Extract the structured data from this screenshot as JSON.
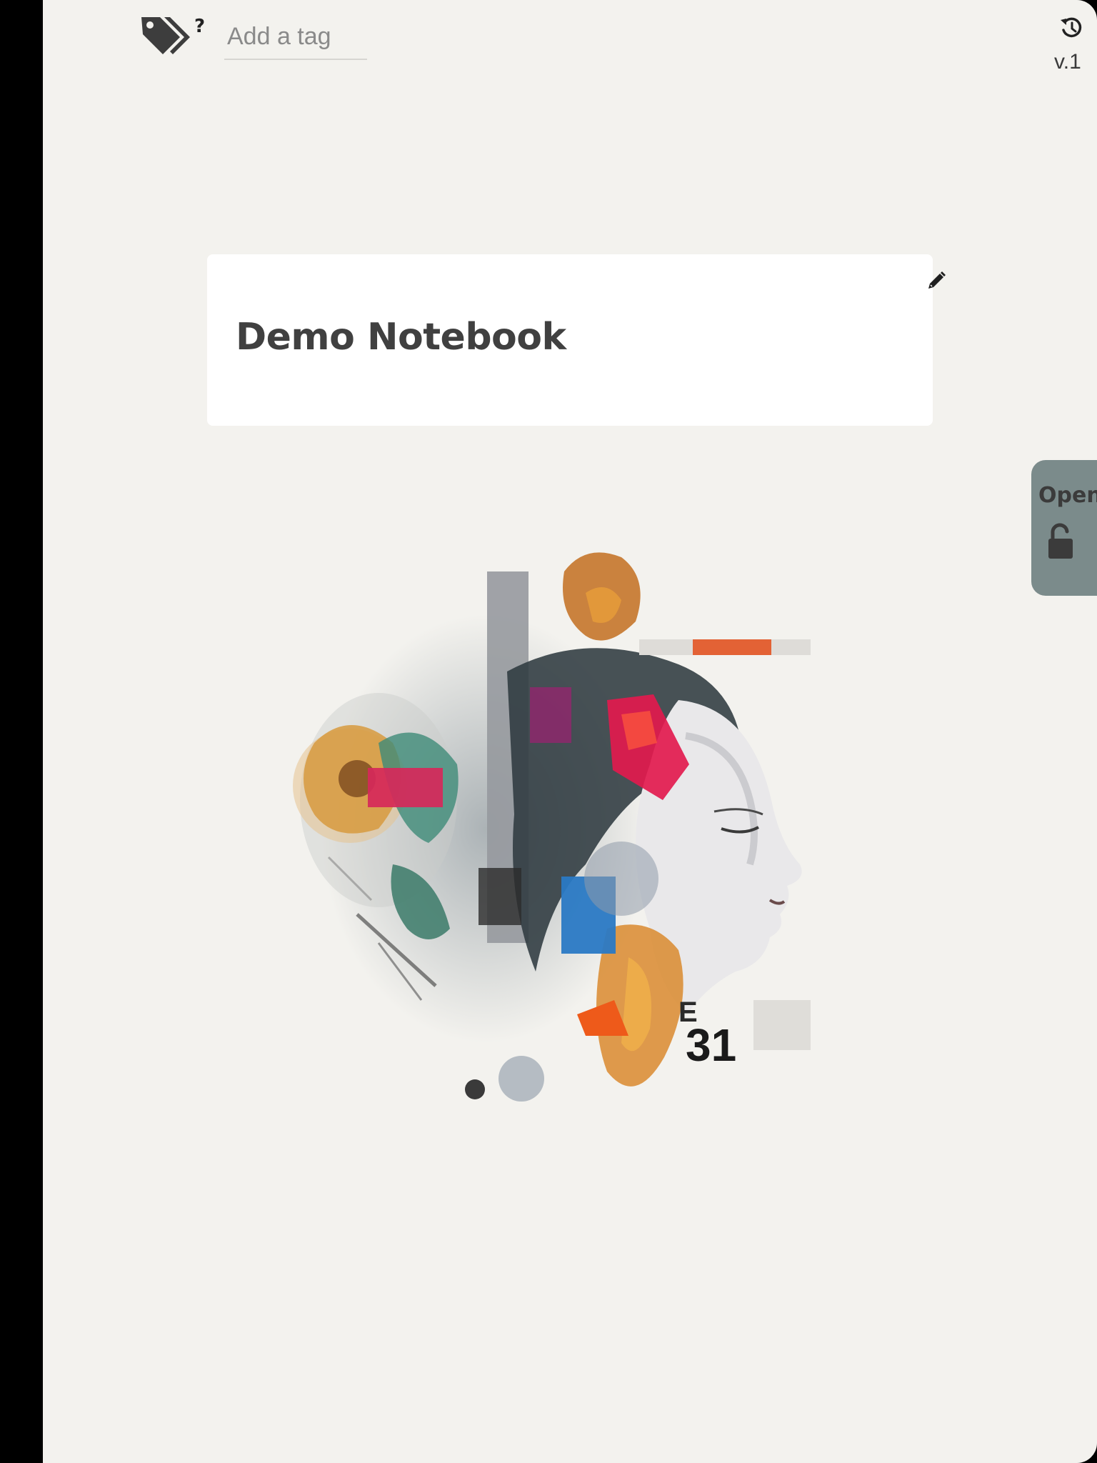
{
  "toolbar": {
    "tag_icon": "tags-icon",
    "help_mark": "?",
    "tag_placeholder": "Add a tag",
    "history_icon": "history-icon",
    "version": "v.1"
  },
  "notebook": {
    "title": "Demo Notebook",
    "edit_icon": "pencil-icon"
  },
  "status_tab": {
    "label": "Open",
    "icon": "unlocked-padlock-icon",
    "color": "#7b8b8b"
  },
  "cover": {
    "description_icon": "collage-portrait-image"
  },
  "colors": {
    "background": "#f3f2ee",
    "card": "#ffffff",
    "left_bar": "#000000"
  }
}
